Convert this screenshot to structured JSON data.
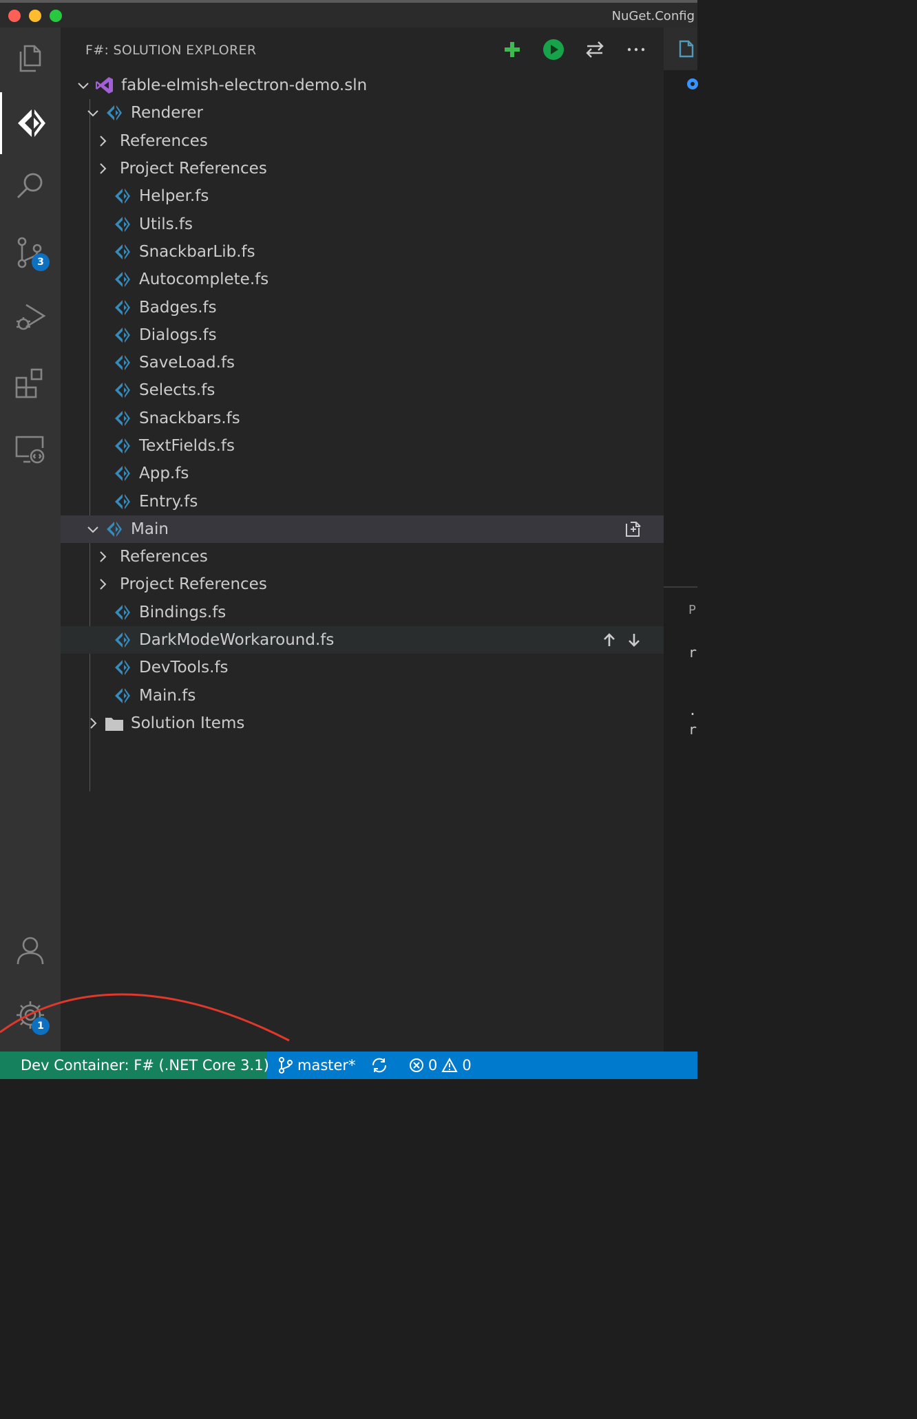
{
  "window": {
    "title": "NuGet.Config"
  },
  "activity_bar": {
    "items": [
      {
        "name": "explorer",
        "icon": "files-icon"
      },
      {
        "name": "fsharp",
        "icon": "fsharp-icon"
      },
      {
        "name": "search",
        "icon": "search-icon"
      },
      {
        "name": "source-control",
        "icon": "source-control-icon",
        "badge": "3"
      },
      {
        "name": "run-debug",
        "icon": "debug-icon"
      },
      {
        "name": "extensions",
        "icon": "extensions-icon"
      },
      {
        "name": "remote-explorer",
        "icon": "remote-explorer-icon"
      }
    ],
    "bottom": [
      {
        "name": "accounts",
        "icon": "account-icon"
      },
      {
        "name": "manage",
        "icon": "gear-icon",
        "badge": "1"
      }
    ]
  },
  "sidebar": {
    "title": "F#: SOLUTION EXPLORER",
    "actions": [
      {
        "name": "add",
        "icon": "plus-icon",
        "color": "#3fb950"
      },
      {
        "name": "run",
        "icon": "run-icon",
        "color": "#16a34a"
      },
      {
        "name": "sync",
        "icon": "swap-icon"
      },
      {
        "name": "more",
        "icon": "ellipsis-icon"
      }
    ],
    "tree": [
      {
        "label": "fable-elmish-electron-demo.sln",
        "type": "solution",
        "expanded": true
      },
      {
        "label": "Renderer",
        "type": "project",
        "expanded": true
      },
      {
        "label": "References",
        "type": "folder-collapsed"
      },
      {
        "label": "Project References",
        "type": "folder-collapsed"
      },
      {
        "label": "Helper.fs",
        "type": "file"
      },
      {
        "label": "Utils.fs",
        "type": "file"
      },
      {
        "label": "SnackbarLib.fs",
        "type": "file"
      },
      {
        "label": "Autocomplete.fs",
        "type": "file"
      },
      {
        "label": "Badges.fs",
        "type": "file"
      },
      {
        "label": "Dialogs.fs",
        "type": "file"
      },
      {
        "label": "SaveLoad.fs",
        "type": "file"
      },
      {
        "label": "Selects.fs",
        "type": "file"
      },
      {
        "label": "Snackbars.fs",
        "type": "file"
      },
      {
        "label": "TextFields.fs",
        "type": "file"
      },
      {
        "label": "App.fs",
        "type": "file"
      },
      {
        "label": "Entry.fs",
        "type": "file"
      },
      {
        "label": "Main",
        "type": "project",
        "expanded": true,
        "selected": true
      },
      {
        "label": "References",
        "type": "folder-collapsed"
      },
      {
        "label": "Project References",
        "type": "folder-collapsed"
      },
      {
        "label": "Bindings.fs",
        "type": "file"
      },
      {
        "label": "DarkModeWorkaround.fs",
        "type": "file",
        "hover": true
      },
      {
        "label": "DevTools.fs",
        "type": "file"
      },
      {
        "label": "Main.fs",
        "type": "file"
      },
      {
        "label": "Solution Items",
        "type": "solution-folder"
      }
    ]
  },
  "editor_fragments": {
    "panel_letter": "P",
    "line1": "r",
    "line2": ".",
    "line3": "r"
  },
  "status_bar": {
    "remote": "Dev Container: F# (.NET Core 3.1)",
    "branch": "master*",
    "errors": "0",
    "warnings": "0",
    "colors": {
      "bar": "#007acc",
      "remote": "#16825d"
    }
  }
}
